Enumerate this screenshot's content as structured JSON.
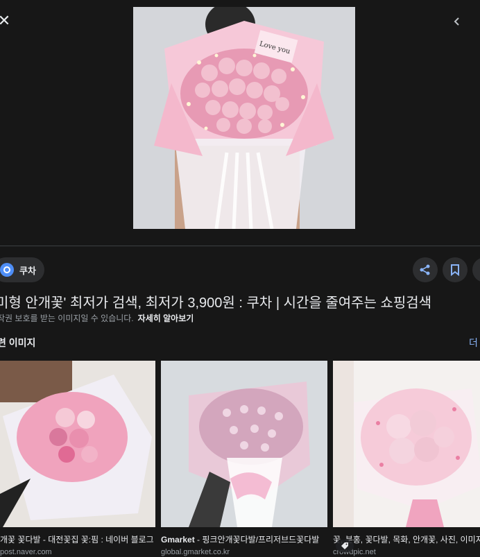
{
  "viewer": {
    "close_glyph": "✕"
  },
  "source": {
    "name": "쿠차",
    "favicon_color": "#4e8ef7"
  },
  "result": {
    "title": "미형 안개꽃' 최저가 검색, 최저가 3,900원 : 쿠차 | 시간을 줄여주는 쇼핑검색",
    "notice": "작권 보호를 받는 이미지일 수 있습니다.",
    "notice_link": "자세히 알아보기"
  },
  "hero_image": {
    "card_text": "Love you"
  },
  "related": {
    "heading": "련 이미지",
    "more": "더",
    "items": [
      {
        "source": "개꽃 꽃다발",
        "title": " - 대전꽃집 꽃:핌 : 네이버 블로그",
        "domain": "post.naver.com"
      },
      {
        "source": "Gmarket",
        "title": " - 핑크안개꽃다발/프리저브드꽃다발",
        "domain": "global.gmarket.co.kr"
      },
      {
        "source": "꽃, 분홍, 꽃다발, 목화, 안개꽃, 사진, 이미지",
        "title": "",
        "domain": "crowdpic.net"
      }
    ]
  },
  "colors": {
    "background": "#171717",
    "accent_link": "#8ab4f8",
    "chip": "#2d2e30"
  }
}
